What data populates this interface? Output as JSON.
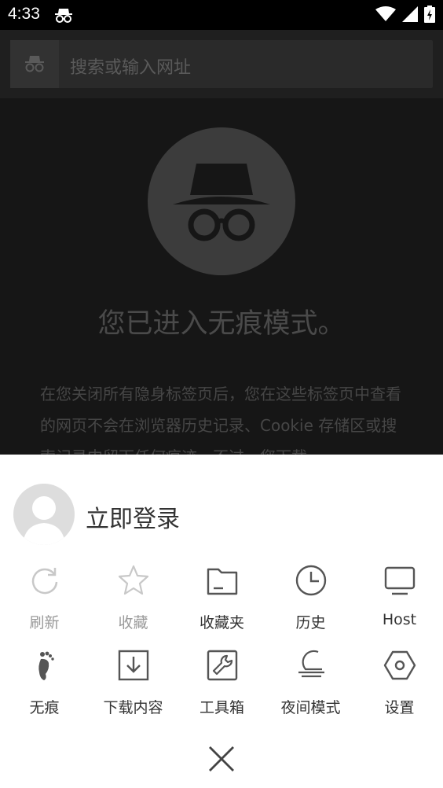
{
  "status_bar": {
    "time": "4:33",
    "icons": [
      "incognito-icon",
      "wifi-icon",
      "signal-icon",
      "battery-charging-icon"
    ]
  },
  "toolbar": {
    "search_placeholder": "搜索或输入网址",
    "left_icon": "incognito-icon"
  },
  "incognito_page": {
    "headline": "您已进入无痕模式。",
    "paragraph": "在您关闭所有隐身标签页后，您在这些标签页中查看的网页不会在浏览器历史记录、Cookie 存储区或搜索记录中留下任何痕迹。不过，您下载"
  },
  "menu": {
    "login_label": "立即登录",
    "items": [
      {
        "label": "刷新",
        "icon": "refresh-icon",
        "enabled": false
      },
      {
        "label": "收藏",
        "icon": "star-icon",
        "enabled": false
      },
      {
        "label": "收藏夹",
        "icon": "folder-icon",
        "enabled": true
      },
      {
        "label": "历史",
        "icon": "clock-icon",
        "enabled": true
      },
      {
        "label": "Host",
        "icon": "monitor-icon",
        "enabled": true
      },
      {
        "label": "无痕",
        "icon": "footprint-icon",
        "enabled": true
      },
      {
        "label": "下载内容",
        "icon": "download-icon",
        "enabled": true
      },
      {
        "label": "工具箱",
        "icon": "wrench-icon",
        "enabled": true
      },
      {
        "label": "夜间模式",
        "icon": "night-mode-icon",
        "enabled": true
      },
      {
        "label": "设置",
        "icon": "settings-hexagon-icon",
        "enabled": true
      }
    ],
    "close_icon": "close-icon"
  }
}
